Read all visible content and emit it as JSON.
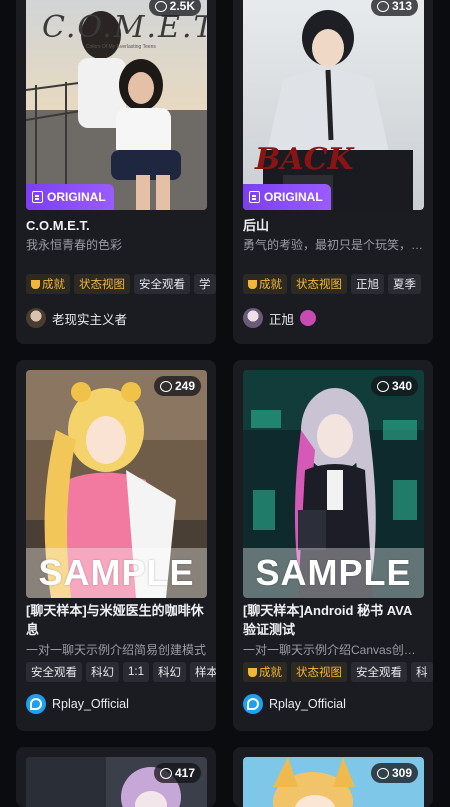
{
  "colors": {
    "background": "#0b0c10",
    "card": "#1b1c22",
    "original_badge": "#8a4df7",
    "gold_tag": "#f3b63a"
  },
  "cards": [
    {
      "count": "2.5K",
      "badge": "ORIGINAL",
      "poster_title": "C.O.M.E.T.",
      "poster_subtitle": "Colors Of My Everlasting Teens",
      "title": "C.O.M.E.T.",
      "desc": "我永恒青春的色彩",
      "tags": [
        "成就",
        "状态视图",
        "安全观看",
        "学"
      ],
      "author": "老现实主义者"
    },
    {
      "count": "313",
      "badge": "ORIGINAL",
      "poster_title": "BACK",
      "title": "后山",
      "desc": "勇气的考验，最初只是个玩笑，…",
      "tags": [
        "成就",
        "状态视图",
        "正旭",
        "夏季"
      ],
      "author": "正旭"
    },
    {
      "count": "249",
      "sample": "SAMPLE",
      "title": "[聊天样本]与米娅医生的咖啡休息",
      "desc": "一对一聊天示例介绍简易创建模式",
      "tags": [
        "安全观看",
        "科幻",
        "1:1",
        "科幻",
        "样本"
      ],
      "author": "Rplay_Official"
    },
    {
      "count": "340",
      "sample": "SAMPLE",
      "title": "[聊天样本]Android 秘书 AVA 验证测试",
      "desc": "一对一聊天示例介绍Canvas创…",
      "tags": [
        "成就",
        "状态视图",
        "安全观看",
        "科"
      ],
      "author": "Rplay_Official"
    },
    {
      "count": "417"
    },
    {
      "count": "309"
    }
  ]
}
